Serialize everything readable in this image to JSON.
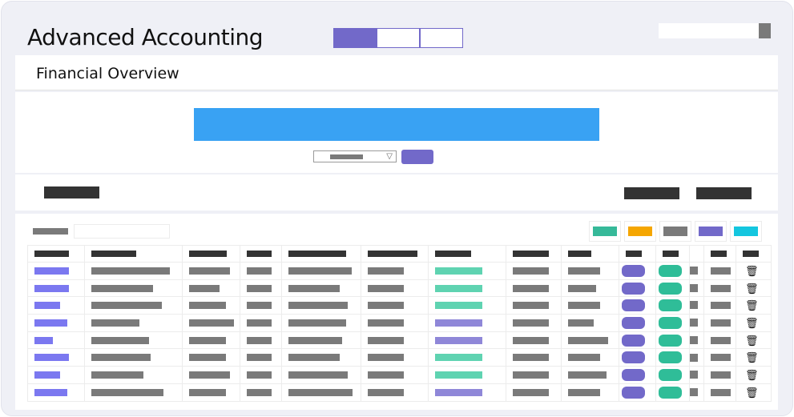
{
  "app": {
    "title": "Advanced Accounting"
  },
  "nav": {
    "segments": [
      {
        "active": true
      },
      {
        "active": false
      },
      {
        "active": false
      }
    ]
  },
  "search": {
    "value": ""
  },
  "overview": {
    "title": "Financial Overview",
    "banner_color": "#39a2f3"
  },
  "colors": {
    "accent": "#7269c9",
    "bar": "#7a7a7a",
    "header": "#333333",
    "teal": "#2fbd98",
    "light_teal": "#5fd3b1",
    "light_purple": "#8f87d8",
    "blue_purple": "#7b78f0"
  },
  "legend": [
    "#36b999",
    "#f5a600",
    "#7a7a7a",
    "#7269c9",
    "#14c6df"
  ],
  "table": {
    "columns": 14,
    "rows": [
      {
        "c0": 43,
        "c1": 98,
        "c2": 51,
        "c3": 31,
        "c4": 79,
        "c5": 45,
        "c6": "teal",
        "c7": 45,
        "c8": 40,
        "c10": 25
      },
      {
        "c0": 43,
        "c1": 77,
        "c2": 38,
        "c3": 31,
        "c4": 64,
        "c5": 45,
        "c6": "teal",
        "c7": 45,
        "c8": 35,
        "c10": 25
      },
      {
        "c0": 32,
        "c1": 88,
        "c2": 46,
        "c3": 31,
        "c4": 74,
        "c5": 45,
        "c6": "teal",
        "c7": 45,
        "c8": 40,
        "c10": 25
      },
      {
        "c0": 41,
        "c1": 60,
        "c2": 56,
        "c3": 31,
        "c4": 72,
        "c5": 45,
        "c6": "purple",
        "c7": 45,
        "c8": 32,
        "c10": 25
      },
      {
        "c0": 23,
        "c1": 72,
        "c2": 46,
        "c3": 31,
        "c4": 67,
        "c5": 45,
        "c6": "purple",
        "c7": 45,
        "c8": 50,
        "c10": 25
      },
      {
        "c0": 43,
        "c1": 74,
        "c2": 46,
        "c3": 31,
        "c4": 64,
        "c5": 45,
        "c6": "teal",
        "c7": 45,
        "c8": 40,
        "c10": 25
      },
      {
        "c0": 32,
        "c1": 65,
        "c2": 51,
        "c3": 31,
        "c4": 74,
        "c5": 45,
        "c6": "teal",
        "c7": 45,
        "c8": 48,
        "c10": 25
      },
      {
        "c0": 41,
        "c1": 90,
        "c2": 46,
        "c3": 31,
        "c4": 80,
        "c5": 45,
        "c6": "purple",
        "c7": 45,
        "c8": 40,
        "c10": 25
      }
    ]
  }
}
